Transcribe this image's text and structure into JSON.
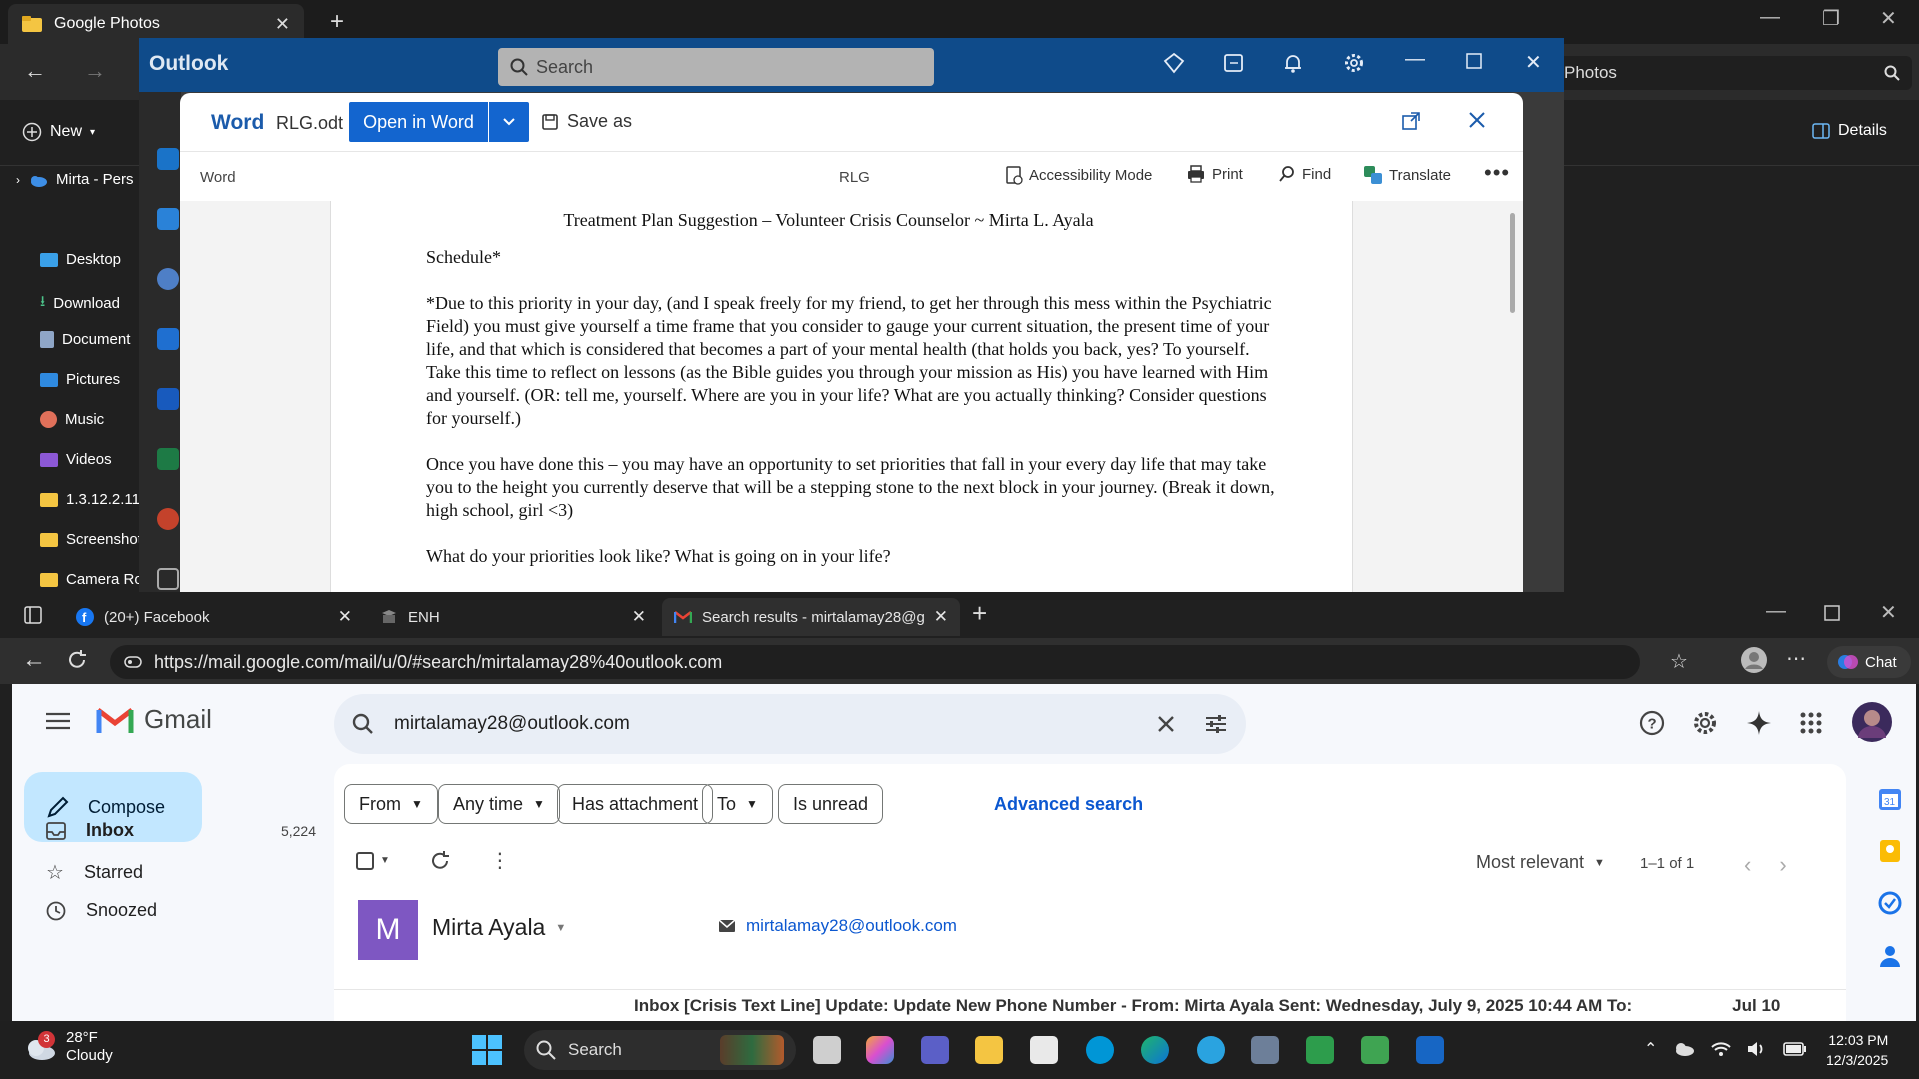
{
  "explorer": {
    "tab_title": "Google Photos",
    "right_title": "Photos",
    "new_label": "New",
    "details_label": "Details",
    "sidebar": [
      "Mirta - Pers",
      "Desktop",
      "Download",
      "Document",
      "Pictures",
      "Music",
      "Videos",
      "1.3.12.2.11",
      "Screenshot",
      "Camera Ro"
    ]
  },
  "outlook": {
    "title": "Outlook",
    "search_placeholder": "Search"
  },
  "word": {
    "app": "Word",
    "file": "RLG.odt",
    "open_label": "Open in Word",
    "save_as": "Save as",
    "sub_app": "Word",
    "doc_title": "RLG",
    "tools": [
      "Accessibility Mode",
      "Print",
      "Find",
      "Translate"
    ],
    "doc": {
      "title": "Treatment Plan Suggestion – Volunteer Crisis Counselor ~ Mirta L. Ayala",
      "heading": "Schedule*",
      "p1": "*Due to this priority in your day, (and I speak freely for my friend, to get her through this mess within the Psychiatric Field) you must give yourself a time frame that you consider to gauge your current situation, the present time of your life, and that which is considered that becomes a part of your mental health (that holds you back, yes? To yourself. Take this time to reflect on lessons (as the Bible guides you through your mission as His) you have learned with Him and yourself. (OR: tell me, yourself. Where are you in your life? What are you actually thinking? Consider questions for yourself.)",
      "p2": "Once you have done this – you may have an opportunity to set priorities that fall in your every day life that may take you to the height you currently deserve that will be a stepping stone to the next block in your journey. (Break it down, high school, girl <3)",
      "p3": "What do your priorities look like? What is going on in your life?"
    }
  },
  "edge": {
    "tabs": [
      "(20+) Facebook",
      "ENH",
      "Search results - mirtalamay28@g"
    ],
    "url": "https://mail.google.com/mail/u/0/#search/mirtalamay28%40outlook.com",
    "chat_label": "Chat"
  },
  "gmail": {
    "logo": "Gmail",
    "query": "mirtalamay28@outlook.com",
    "compose": "Compose",
    "nav": [
      {
        "label": "Inbox",
        "count": "5,224"
      },
      {
        "label": "Starred",
        "count": ""
      },
      {
        "label": "Snoozed",
        "count": ""
      }
    ],
    "chips": [
      "From",
      "Any time",
      "Has attachment",
      "To",
      "Is unread"
    ],
    "advanced_search": "Advanced search",
    "sort": "Most relevant",
    "count": "1–1 of 1",
    "contact": {
      "initial": "M",
      "name": "Mirta Ayala",
      "email": "mirtalamay28@outlook.com"
    },
    "row_preview": "Inbox  [Crisis Text Line] Update: Update New Phone Number - From: Mirta Ayala Sent: Wednesday, July 9, 2025 10:44 AM To:",
    "row_date": "Jul 10"
  },
  "taskbar": {
    "temp": "28°F",
    "condition": "Cloudy",
    "badge": "3",
    "search": "Search",
    "time": "12:03 PM",
    "date": "12/3/2025"
  }
}
